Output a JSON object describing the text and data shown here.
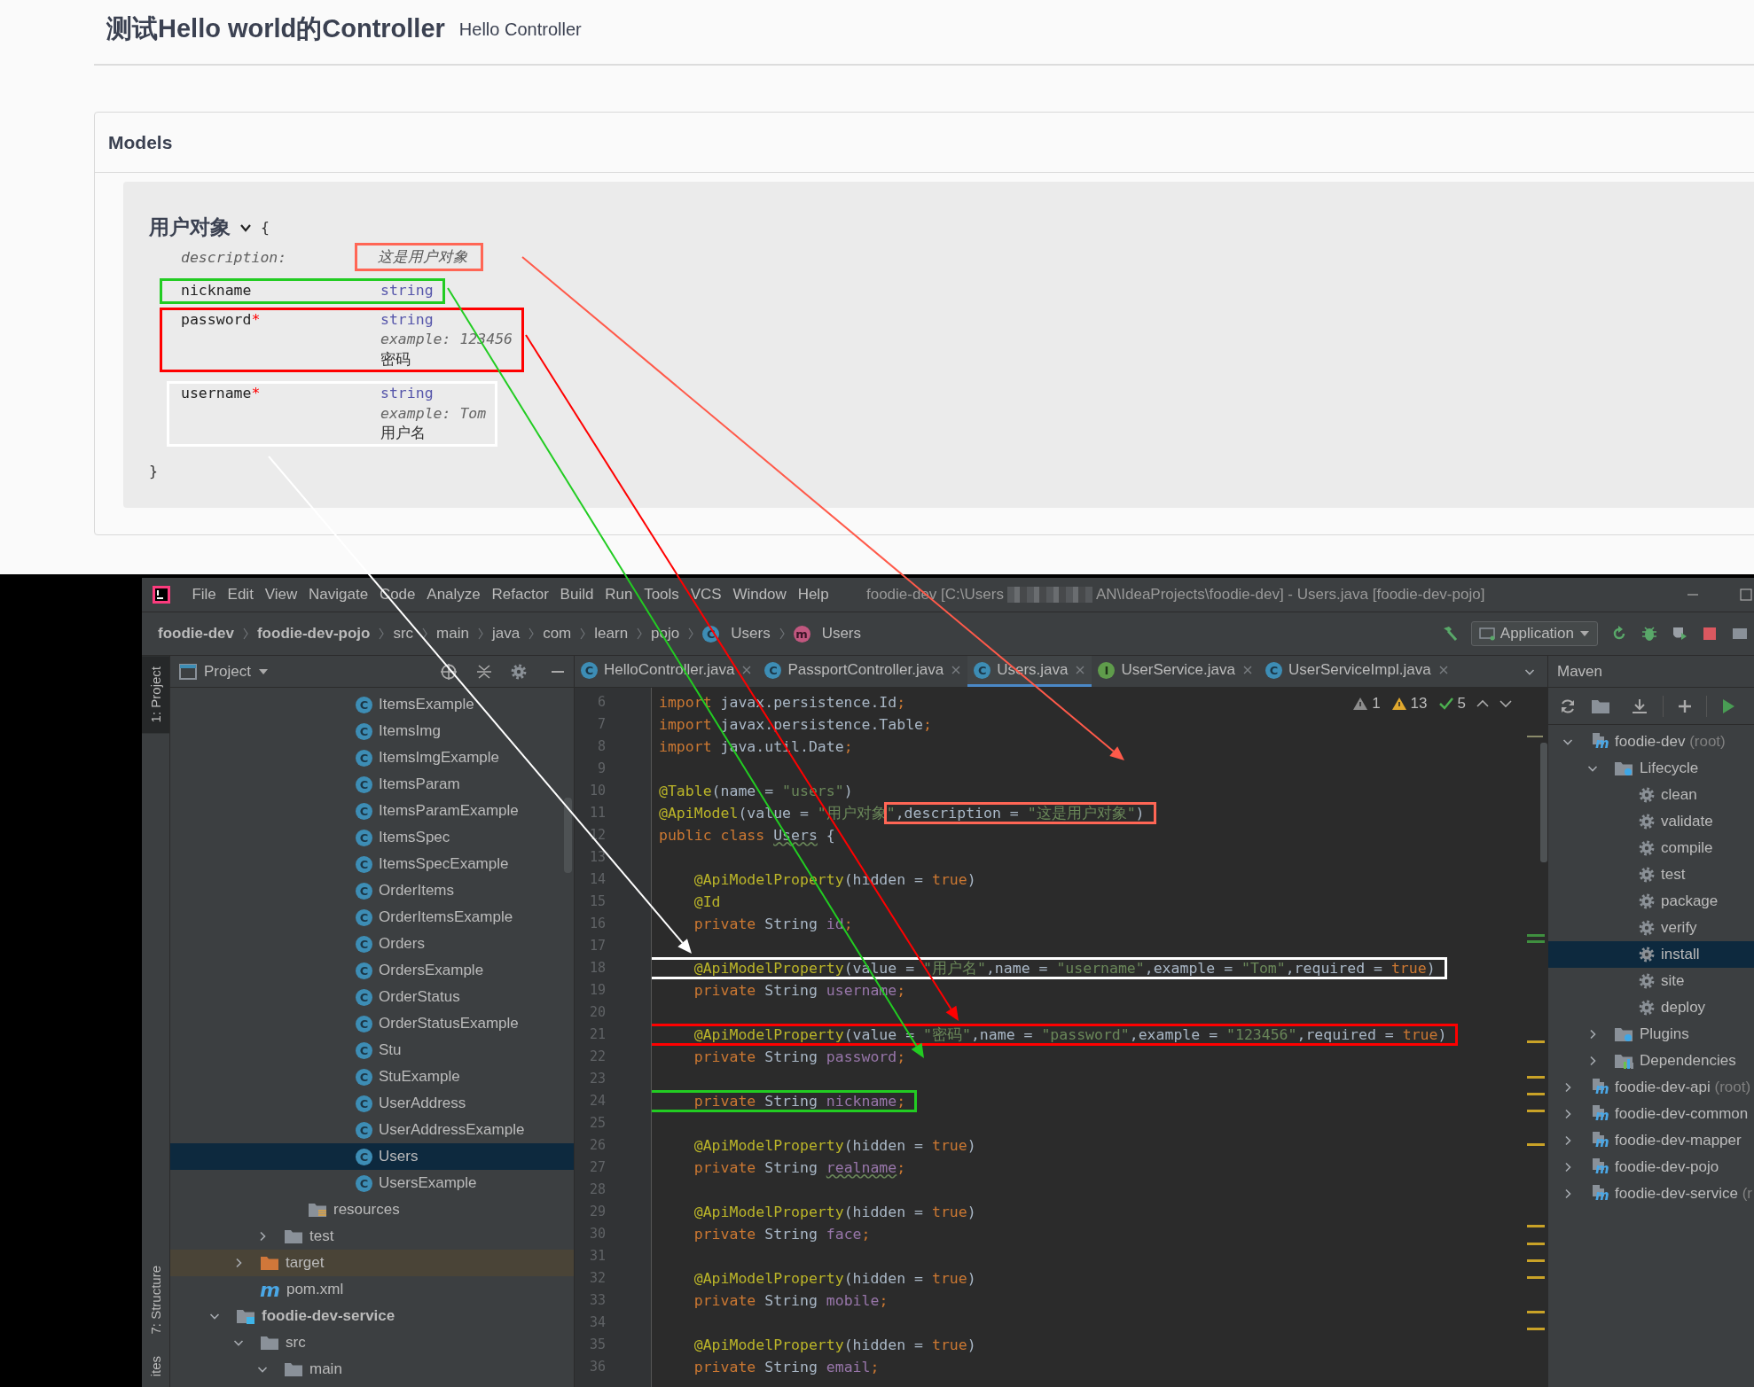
{
  "doc_header": {
    "title": "测试Hello world的Controller",
    "subtitle": "Hello Controller"
  },
  "models": {
    "heading": "Models",
    "model": {
      "name": "用户对象",
      "expanded": true,
      "open_brace": "{",
      "close_brace": "}",
      "description": {
        "label": "description:",
        "text": "这是用户对象",
        "color": "#ff6655"
      },
      "properties": [
        {
          "name": "nickname",
          "type": "string",
          "color": "#22cc22"
        },
        {
          "name": "password",
          "required_mark": "*",
          "type": "string",
          "example_label": "example:",
          "example": "123456",
          "description": "密码",
          "color": "#ff0000"
        },
        {
          "name": "username",
          "required_mark": "*",
          "type": "string",
          "example_label": "example:",
          "example": "Tom",
          "description": "用户名",
          "color": "#ffffff"
        }
      ]
    }
  },
  "ide": {
    "menu": [
      "File",
      "Edit",
      "View",
      "Navigate",
      "Code",
      "Analyze",
      "Refactor",
      "Build",
      "Run",
      "Tools",
      "VCS",
      "Window",
      "Help"
    ],
    "title_start": "foodie-dev [C:\\Users",
    "title_end": "AN\\IdeaProjects\\foodie-dev] - Users.java [foodie-dev-pojo]",
    "breadcrumbs": [
      {
        "label": "foodie-dev",
        "bold": true
      },
      {
        "label": "foodie-dev-pojo",
        "bold": true
      },
      {
        "label": "src",
        "bold": false
      },
      {
        "label": "main",
        "bold": false
      },
      {
        "label": "java",
        "bold": false
      },
      {
        "label": "com",
        "bold": false
      },
      {
        "label": "learn",
        "bold": false
      },
      {
        "label": "pojo",
        "bold": false
      },
      {
        "label": "Users",
        "bold": false,
        "kind": "class",
        "badge": "C"
      },
      {
        "label": "Users",
        "bold": false,
        "kind": "method",
        "badge": "m"
      }
    ],
    "run_config": "Application",
    "side_stripe": [
      {
        "label": "1: Project",
        "selected": true
      },
      {
        "label": "7: Structure",
        "selected": false
      },
      {
        "label": "ites",
        "selected": false
      }
    ],
    "project_panel": {
      "title": "Project",
      "tree": [
        {
          "children": [
            {
              "children": [
                {
                  "children": [
                    {
                      "children": [
                        {
                          "children": [
                            {
                              "label": "ItemsExample",
                              "kind": "class",
                              "badge": "C",
                              "selected": false
                            },
                            {
                              "label": "ItemsImg",
                              "kind": "class",
                              "badge": "C",
                              "selected": false
                            },
                            {
                              "label": "ItemsImgExample",
                              "kind": "class",
                              "badge": "C",
                              "selected": false
                            },
                            {
                              "label": "ItemsParam",
                              "kind": "class",
                              "badge": "C",
                              "selected": false
                            },
                            {
                              "label": "ItemsParamExample",
                              "kind": "class",
                              "badge": "C",
                              "selected": false
                            },
                            {
                              "label": "ItemsSpec",
                              "kind": "class",
                              "badge": "C",
                              "selected": false
                            },
                            {
                              "label": "ItemsSpecExample",
                              "kind": "class",
                              "badge": "C",
                              "selected": false
                            },
                            {
                              "label": "OrderItems",
                              "kind": "class",
                              "badge": "C",
                              "selected": false
                            },
                            {
                              "label": "OrderItemsExample",
                              "kind": "class",
                              "badge": "C",
                              "selected": false
                            },
                            {
                              "label": "Orders",
                              "kind": "class",
                              "badge": "C",
                              "selected": false
                            },
                            {
                              "label": "OrdersExample",
                              "kind": "class",
                              "badge": "C",
                              "selected": false
                            },
                            {
                              "label": "OrderStatus",
                              "kind": "class",
                              "badge": "C",
                              "selected": false
                            },
                            {
                              "label": "OrderStatusExample",
                              "kind": "class",
                              "badge": "C",
                              "selected": false
                            },
                            {
                              "label": "Stu",
                              "kind": "class",
                              "badge": "C",
                              "selected": false
                            },
                            {
                              "label": "StuExample",
                              "kind": "class",
                              "badge": "C",
                              "selected": false
                            },
                            {
                              "label": "UserAddress",
                              "kind": "class",
                              "badge": "C",
                              "selected": false
                            },
                            {
                              "label": "UserAddressExample",
                              "kind": "class",
                              "badge": "C",
                              "selected": false
                            },
                            {
                              "label": "Users",
                              "kind": "class",
                              "badge": "C",
                              "selected": true
                            },
                            {
                              "label": "UsersExample",
                              "kind": "class",
                              "badge": "C",
                              "selected": false
                            }
                          ]
                        }
                      ]
                    },
                    {
                      "label": "resources",
                      "kind": "resources-folder",
                      "selected": false
                    }
                  ]
                },
                {
                  "label": "test",
                  "kind": "folder",
                  "expanded": false,
                  "selected": false
                }
              ]
            },
            {
              "label": "target",
              "kind": "excluded-folder",
              "expanded": false,
              "selected": false
            },
            {
              "label": "pom.xml",
              "kind": "maven-file",
              "badge": "m",
              "selected": false
            }
          ]
        },
        {
          "label": "foodie-dev-service",
          "kind": "module",
          "expanded": true,
          "selected": false,
          "children": [
            {
              "label": "src",
              "kind": "folder",
              "expanded": true,
              "selected": false,
              "children": [
                {
                  "label": "main",
                  "kind": "folder",
                  "expanded": true,
                  "selected": false
                }
              ]
            }
          ]
        }
      ]
    },
    "tabs": [
      {
        "label": "HelloController.java",
        "badge": "C",
        "kind": "class",
        "selected": false
      },
      {
        "label": "PassportController.java",
        "badge": "C",
        "kind": "class",
        "selected": false
      },
      {
        "label": "Users.java",
        "badge": "C",
        "kind": "class",
        "selected": true
      },
      {
        "label": "UserService.java",
        "badge": "I",
        "kind": "interface",
        "selected": false
      },
      {
        "label": "UserServiceImpl.java",
        "badge": "C",
        "kind": "class",
        "selected": false
      }
    ],
    "editor": {
      "inspections": [
        {
          "kind": "weak-warning",
          "count": "1"
        },
        {
          "kind": "warning",
          "count": "13"
        },
        {
          "kind": "typo",
          "count": "5"
        }
      ],
      "lines": [
        {
          "number": "6",
          "tokens": [
            {
              "kind": "keyword",
              "text": "import"
            },
            {
              "kind": "plain",
              "text": " javax.persistence.Id"
            },
            {
              "kind": "keyword",
              "text": ";"
            }
          ]
        },
        {
          "number": "7",
          "tokens": [
            {
              "kind": "keyword",
              "text": "import"
            },
            {
              "kind": "plain",
              "text": " javax.persistence.Table"
            },
            {
              "kind": "keyword",
              "text": ";"
            }
          ]
        },
        {
          "number": "8",
          "tokens": [
            {
              "kind": "keyword",
              "text": "import"
            },
            {
              "kind": "plain",
              "text": " java.util.Date"
            },
            {
              "kind": "keyword",
              "text": ";"
            }
          ]
        },
        {
          "number": "9"
        },
        {
          "number": "10",
          "tokens": [
            {
              "kind": "annotation",
              "text": "@Table"
            },
            {
              "kind": "plain",
              "text": "(name = "
            },
            {
              "kind": "string",
              "text": "\"users\""
            },
            {
              "kind": "plain",
              "text": ")"
            }
          ]
        },
        {
          "number": "11",
          "tokens": [
            {
              "kind": "annotation",
              "text": "@ApiModel"
            },
            {
              "kind": "plain",
              "text": "(value = "
            },
            {
              "kind": "string",
              "text": "\"用户对象\""
            },
            {
              "kind": "group",
              "color": "#ff6655",
              "tokens": [
                {
                  "kind": "plain",
                  "text": ",description = "
                },
                {
                  "kind": "string",
                  "text": "\"这是用户对象\""
                },
                {
                  "kind": "plain",
                  "text": ")"
                }
              ]
            }
          ]
        },
        {
          "number": "12",
          "tokens": [
            {
              "kind": "keyword",
              "text": "public class "
            },
            {
              "kind": "name-typo",
              "text": "Users"
            },
            {
              "kind": "plain",
              "text": " {"
            }
          ]
        },
        {
          "number": "13"
        },
        {
          "number": "14",
          "tokens": [
            {
              "kind": "annotation",
              "text": "    @ApiModelProperty"
            },
            {
              "kind": "plain",
              "text": "(hidden = "
            },
            {
              "kind": "keyword",
              "text": "true"
            },
            {
              "kind": "plain",
              "text": ")"
            }
          ]
        },
        {
          "number": "15",
          "tokens": [
            {
              "kind": "annotation",
              "text": "    @Id"
            }
          ]
        },
        {
          "number": "16",
          "tokens": [
            {
              "kind": "keyword",
              "text": "    private "
            },
            {
              "kind": "plain",
              "text": "String "
            },
            {
              "kind": "field",
              "text": "id"
            },
            {
              "kind": "keyword",
              "text": ";"
            }
          ]
        },
        {
          "number": "17"
        },
        {
          "number": "18",
          "tokens": [
            {
              "kind": "group",
              "color": "#ffffff",
              "tokens": [
                {
                  "kind": "annotation",
                  "text": "    @ApiModelProperty"
                },
                {
                  "kind": "plain",
                  "text": "(value = "
                },
                {
                  "kind": "string",
                  "text": "\"用户名\""
                },
                {
                  "kind": "plain",
                  "text": ",name = "
                },
                {
                  "kind": "string",
                  "text": "\"username\""
                },
                {
                  "kind": "plain",
                  "text": ",example = "
                },
                {
                  "kind": "string",
                  "text": "\"Tom\""
                },
                {
                  "kind": "plain",
                  "text": ",required = "
                },
                {
                  "kind": "keyword",
                  "text": "true"
                },
                {
                  "kind": "plain",
                  "text": ")"
                }
              ]
            }
          ]
        },
        {
          "number": "19",
          "tokens": [
            {
              "kind": "keyword",
              "text": "    private "
            },
            {
              "kind": "plain",
              "text": "String "
            },
            {
              "kind": "field",
              "text": "username"
            },
            {
              "kind": "keyword",
              "text": ";"
            }
          ]
        },
        {
          "number": "20"
        },
        {
          "number": "21",
          "tokens": [
            {
              "kind": "group",
              "color": "#ff0000",
              "tokens": [
                {
                  "kind": "annotation",
                  "text": "    @ApiModelProperty"
                },
                {
                  "kind": "plain",
                  "text": "(value = "
                },
                {
                  "kind": "string",
                  "text": "\"密码\""
                },
                {
                  "kind": "plain",
                  "text": ",name = "
                },
                {
                  "kind": "string",
                  "text": "\"password\""
                },
                {
                  "kind": "plain",
                  "text": ",example = "
                },
                {
                  "kind": "string",
                  "text": "\"123456\""
                },
                {
                  "kind": "plain",
                  "text": ",required = "
                },
                {
                  "kind": "keyword",
                  "text": "true"
                },
                {
                  "kind": "plain",
                  "text": ")"
                }
              ]
            }
          ]
        },
        {
          "number": "22",
          "tokens": [
            {
              "kind": "keyword",
              "text": "    private "
            },
            {
              "kind": "plain",
              "text": "String "
            },
            {
              "kind": "field",
              "text": "password"
            },
            {
              "kind": "keyword",
              "text": ";"
            }
          ]
        },
        {
          "number": "23"
        },
        {
          "number": "24",
          "tokens": [
            {
              "kind": "group",
              "color": "#22cc22",
              "tokens": [
                {
                  "kind": "keyword",
                  "text": "    private "
                },
                {
                  "kind": "plain",
                  "text": "String "
                },
                {
                  "kind": "field",
                  "text": "nickname"
                },
                {
                  "kind": "keyword",
                  "text": ";"
                }
              ]
            }
          ]
        },
        {
          "number": "25"
        },
        {
          "number": "26",
          "tokens": [
            {
              "kind": "annotation",
              "text": "    @ApiModelProperty"
            },
            {
              "kind": "plain",
              "text": "(hidden = "
            },
            {
              "kind": "keyword",
              "text": "true"
            },
            {
              "kind": "plain",
              "text": ")"
            }
          ]
        },
        {
          "number": "27",
          "tokens": [
            {
              "kind": "keyword",
              "text": "    private "
            },
            {
              "kind": "plain",
              "text": "String "
            },
            {
              "kind": "field-typo",
              "text": "realname"
            },
            {
              "kind": "keyword",
              "text": ";"
            }
          ]
        },
        {
          "number": "28"
        },
        {
          "number": "29",
          "tokens": [
            {
              "kind": "annotation",
              "text": "    @ApiModelProperty"
            },
            {
              "kind": "plain",
              "text": "(hidden = "
            },
            {
              "kind": "keyword",
              "text": "true"
            },
            {
              "kind": "plain",
              "text": ")"
            }
          ]
        },
        {
          "number": "30",
          "tokens": [
            {
              "kind": "keyword",
              "text": "    private "
            },
            {
              "kind": "plain",
              "text": "String "
            },
            {
              "kind": "field",
              "text": "face"
            },
            {
              "kind": "keyword",
              "text": ";"
            }
          ]
        },
        {
          "number": "31"
        },
        {
          "number": "32",
          "tokens": [
            {
              "kind": "annotation",
              "text": "    @ApiModelProperty"
            },
            {
              "kind": "plain",
              "text": "(hidden = "
            },
            {
              "kind": "keyword",
              "text": "true"
            },
            {
              "kind": "plain",
              "text": ")"
            }
          ]
        },
        {
          "number": "33",
          "tokens": [
            {
              "kind": "keyword",
              "text": "    private "
            },
            {
              "kind": "plain",
              "text": "String "
            },
            {
              "kind": "field",
              "text": "mobile"
            },
            {
              "kind": "keyword",
              "text": ";"
            }
          ]
        },
        {
          "number": "34"
        },
        {
          "number": "35",
          "tokens": [
            {
              "kind": "annotation",
              "text": "    @ApiModelProperty"
            },
            {
              "kind": "plain",
              "text": "(hidden = "
            },
            {
              "kind": "keyword",
              "text": "true"
            },
            {
              "kind": "plain",
              "text": ")"
            }
          ]
        },
        {
          "number": "36",
          "tokens": [
            {
              "kind": "keyword",
              "text": "    private "
            },
            {
              "kind": "plain",
              "text": "String "
            },
            {
              "kind": "field",
              "text": "email"
            },
            {
              "kind": "keyword",
              "text": ";"
            }
          ]
        }
      ]
    },
    "maven": {
      "title": "Maven",
      "tree": [
        {
          "label": "foodie-dev",
          "note": "(root)",
          "kind": "maven-module",
          "badge": "m",
          "expanded": true,
          "selected": false,
          "children": [
            {
              "label": "Lifecycle",
              "kind": "lifecycle-folder",
              "expanded": true,
              "selected": false,
              "children": [
                {
                  "label": "clean",
                  "kind": "gear",
                  "selected": false
                },
                {
                  "label": "validate",
                  "kind": "gear",
                  "selected": false
                },
                {
                  "label": "compile",
                  "kind": "gear",
                  "selected": false
                },
                {
                  "label": "test",
                  "kind": "gear",
                  "selected": false
                },
                {
                  "label": "package",
                  "kind": "gear",
                  "selected": false
                },
                {
                  "label": "verify",
                  "kind": "gear",
                  "selected": false
                },
                {
                  "label": "install",
                  "kind": "gear",
                  "selected": true
                },
                {
                  "label": "site",
                  "kind": "gear",
                  "selected": false
                },
                {
                  "label": "deploy",
                  "kind": "gear",
                  "selected": false
                }
              ]
            },
            {
              "label": "Plugins",
              "kind": "lifecycle-folder",
              "expanded": false,
              "selected": false
            },
            {
              "label": "Dependencies",
              "kind": "dependencies-folder",
              "expanded": false,
              "selected": false
            }
          ]
        },
        {
          "label": "foodie-dev-api",
          "note": "(root)",
          "kind": "maven-module",
          "badge": "m",
          "expanded": false,
          "selected": false
        },
        {
          "label": "foodie-dev-common",
          "kind": "maven-module",
          "badge": "m",
          "expanded": false,
          "selected": false
        },
        {
          "label": "foodie-dev-mapper",
          "kind": "maven-module",
          "badge": "m",
          "expanded": false,
          "selected": false
        },
        {
          "label": "foodie-dev-pojo",
          "kind": "maven-module",
          "badge": "m",
          "expanded": false,
          "selected": false
        },
        {
          "label": "foodie-dev-service",
          "note": "(r",
          "kind": "maven-module",
          "badge": "m",
          "expanded": false,
          "selected": false
        }
      ]
    }
  },
  "arrows": [
    {
      "color": "#ff5a4a"
    },
    {
      "color": "#ff0000"
    },
    {
      "color": "#22cc22"
    },
    {
      "color": "#ffffff"
    }
  ]
}
